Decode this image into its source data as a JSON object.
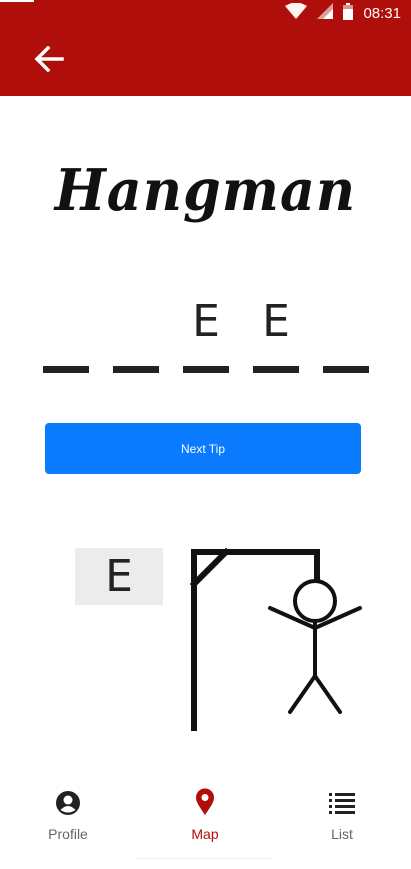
{
  "status_bar": {
    "time": "08:31",
    "icons": [
      "wifi-icon",
      "signal-icon",
      "battery-icon"
    ]
  },
  "app_bar": {
    "back_icon": "arrow-left-icon",
    "color": "#b00e0a"
  },
  "game": {
    "title": "Hangman",
    "word_slots": [
      "",
      "",
      "E",
      "E",
      ""
    ],
    "next_tip_label": "Next Tip",
    "guessed_letters": [
      "E"
    ],
    "button_color": "#0a7bff"
  },
  "bottom_nav": {
    "items": [
      {
        "label": "Profile",
        "icon": "profile-icon"
      },
      {
        "label": "Map",
        "icon": "map-pin-icon",
        "active": true
      },
      {
        "label": "List",
        "icon": "list-icon"
      }
    ],
    "active_color": "#b00e0a"
  }
}
